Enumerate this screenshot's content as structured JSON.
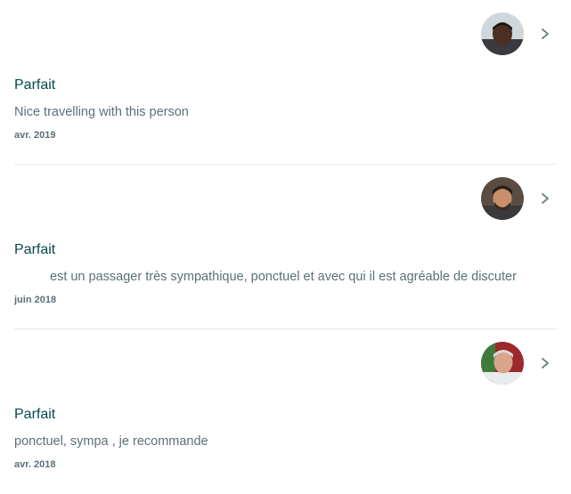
{
  "reviews": [
    {
      "rating": "Parfait",
      "comment_prefix": "",
      "comment": "Nice travelling with this person",
      "date": "avr. 2019",
      "avatar": {
        "skin": "#4a2f22",
        "shirt": "#3b3a40",
        "bg": "#cfd6dc"
      }
    },
    {
      "rating": "Parfait",
      "comment_prefix": "",
      "comment": "est un passager très sympathique, ponctuel et avec qui il est agréable de discuter",
      "date": "juin 2018",
      "avatar": {
        "skin": "#c98f6a",
        "shirt": "#3a3a3a",
        "bg": "#5b4c42"
      }
    },
    {
      "rating": "Parfait",
      "comment_prefix": "",
      "comment": "ponctuel, sympa , je recommande",
      "date": "avr. 2018",
      "avatar": {
        "skin": "#d9a58a",
        "shirt": "#e9ecef",
        "bg": "#9c2a2a"
      }
    }
  ],
  "icons": {
    "chevron": "chevron-right-icon"
  },
  "colors": {
    "title": "#054752",
    "text": "#5b7077",
    "divider": "#e6e9ea",
    "chevron": "#6f8287"
  }
}
